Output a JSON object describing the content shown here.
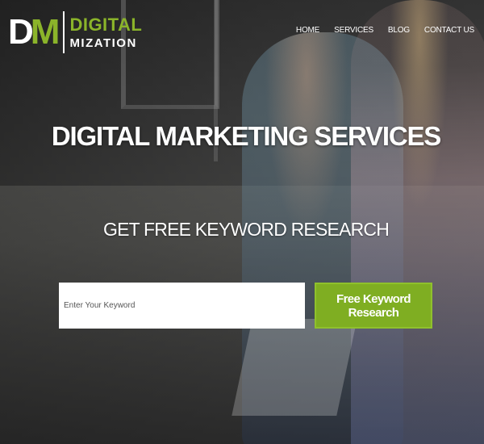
{
  "logo": {
    "mark_d": "D",
    "mark_m": "M",
    "line1": "DIGITAL",
    "line2": "MIZATION"
  },
  "nav": {
    "items": [
      {
        "label": "HOME"
      },
      {
        "label": "SERVICES"
      },
      {
        "label": "BLOG"
      },
      {
        "label": "CONTACT US"
      }
    ]
  },
  "hero": {
    "headline": "DIGITAL MARKETING SERVICES",
    "subhead": "GET FREE KEYWORD RESEARCH"
  },
  "search": {
    "placeholder": "Enter Your Keyword",
    "value": "",
    "button_label": "Free Keyword Research"
  },
  "colors": {
    "accent": "#8bb42a",
    "button": "#7fae22",
    "text": "#ffffff"
  }
}
